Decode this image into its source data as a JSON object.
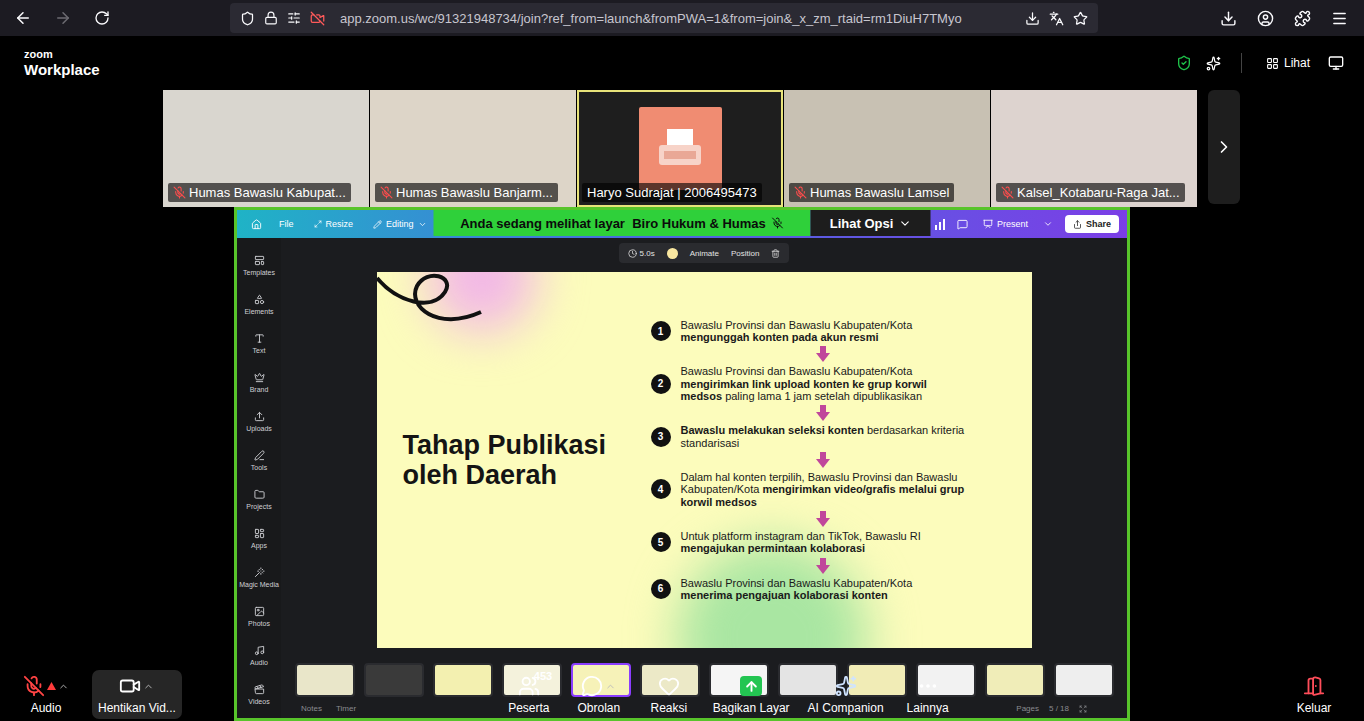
{
  "browser": {
    "url": "app.zoom.us/wc/91321948734/join?ref_from=launch&fromPWA=1&from=join&_x_zm_rtaid=rm1DiuH7TMyo",
    "forward_disabled": true
  },
  "zoom_header": {
    "brand_top": "zoom",
    "brand_bottom": "Workplace",
    "view_label": "Lihat"
  },
  "participants": [
    {
      "name": "Humas Bawaslu Kabupat...",
      "muted": true,
      "active": false,
      "kind": "video",
      "color": "#d9d6cf"
    },
    {
      "name": "Humas Bawaslu Banjarm...",
      "muted": true,
      "active": false,
      "kind": "video",
      "color": "#ddd5c8"
    },
    {
      "name": "Haryo Sudrajat | 2006495473",
      "muted": false,
      "active": true,
      "kind": "avatar",
      "color": "#1e1e1e"
    },
    {
      "name": "Humas Bawaslu Lamsel",
      "muted": true,
      "active": false,
      "kind": "video",
      "color": "#c8c1b3"
    },
    {
      "name": "Kalsel_Kotabaru-Raga Jat...",
      "muted": true,
      "active": false,
      "kind": "video",
      "color": "#ddd3cf"
    }
  ],
  "share_banner": {
    "text": "Anda sedang melihat layar  Biro Hukum & Humas",
    "options": "Lihat Opsi"
  },
  "canva": {
    "menu": [
      "File",
      "Resize",
      "Editing"
    ],
    "present": "Present",
    "share": "Share",
    "sidebar": [
      "Templates",
      "Elements",
      "Text",
      "Brand",
      "Uploads",
      "Tools",
      "Projects",
      "Apps",
      "Magic Media",
      "Photos",
      "Audio",
      "Videos"
    ],
    "slide_toolbar": {
      "duration": "5.0s",
      "animate": "Animate",
      "position": "Position"
    },
    "slide": {
      "title": "Tahap Publikasi oleh Daerah",
      "steps": [
        {
          "number": "1",
          "segments": [
            {
              "text": "Bawaslu Provinsi dan Bawaslu Kabupaten/Kota ",
              "bold": false
            },
            {
              "text": "mengunggah konten pada akun resmi",
              "bold": true
            }
          ]
        },
        {
          "number": "2",
          "segments": [
            {
              "text": "Bawaslu Provinsi dan Bawaslu Kabupaten/Kota ",
              "bold": false
            },
            {
              "text": "mengirimkan link upload konten ke grup korwil medsos",
              "bold": true
            },
            {
              "text": " paling lama 1 jam setelah dipublikasikan",
              "bold": false
            }
          ]
        },
        {
          "number": "3",
          "segments": [
            {
              "text": "Bawaslu melakukan seleksi konten",
              "bold": true
            },
            {
              "text": " berdasarkan kriteria standarisasi",
              "bold": false
            }
          ]
        },
        {
          "number": "4",
          "segments": [
            {
              "text": "Dalam hal konten terpilih, Bawaslu Provinsi dan Bawaslu Kabupaten/Kota ",
              "bold": false
            },
            {
              "text": "mengirimkan video/grafis melalui grup korwil medsos",
              "bold": true
            }
          ]
        },
        {
          "number": "5",
          "segments": [
            {
              "text": "Untuk platform instagram dan TikTok, Bawaslu RI ",
              "bold": false
            },
            {
              "text": "mengajukan permintaan kolaborasi",
              "bold": true
            }
          ]
        },
        {
          "number": "6",
          "segments": [
            {
              "text": "Bawaslu Provinsi dan Bawaslu Kabupaten/Kota ",
              "bold": false
            },
            {
              "text": "menerima pengajuan kolaborasi konten",
              "bold": true
            }
          ]
        }
      ]
    },
    "thumbnails": [
      {
        "selected": false,
        "color": "#e9e6c9"
      },
      {
        "selected": false,
        "color": "#3a3a3a"
      },
      {
        "selected": false,
        "color": "#f3f0b0"
      },
      {
        "selected": false,
        "color": "#f4f2dc"
      },
      {
        "selected": true,
        "color": "#f6f2b8"
      },
      {
        "selected": false,
        "color": "#ece9c7"
      },
      {
        "selected": false,
        "color": "#f5f5f5"
      },
      {
        "selected": false,
        "color": "#e4e4e4"
      },
      {
        "selected": false,
        "color": "#f1ecb6"
      },
      {
        "selected": false,
        "color": "#f2f2f2"
      },
      {
        "selected": false,
        "color": "#f0edb8"
      },
      {
        "selected": false,
        "color": "#eeeeee"
      }
    ],
    "footer": {
      "notes": "Notes",
      "timer": "Timer",
      "pages": "Pages",
      "page_count": "5 / 18"
    }
  },
  "toolbar": {
    "audio": {
      "label": "Audio",
      "muted": true
    },
    "video": {
      "label": "Hentikan Vid..."
    },
    "items": [
      {
        "label": "Peserta",
        "badge": "453",
        "menu": false
      },
      {
        "label": "Obrolan",
        "badge": "",
        "menu": true
      },
      {
        "label": "Reaksi",
        "badge": "",
        "menu": false
      },
      {
        "label": "Bagikan Layar",
        "badge": "",
        "menu": false
      },
      {
        "label": "AI Companion",
        "badge": "",
        "menu": false
      },
      {
        "label": "Lainnya",
        "badge": "",
        "menu": false
      }
    ],
    "exit": "Keluar"
  }
}
